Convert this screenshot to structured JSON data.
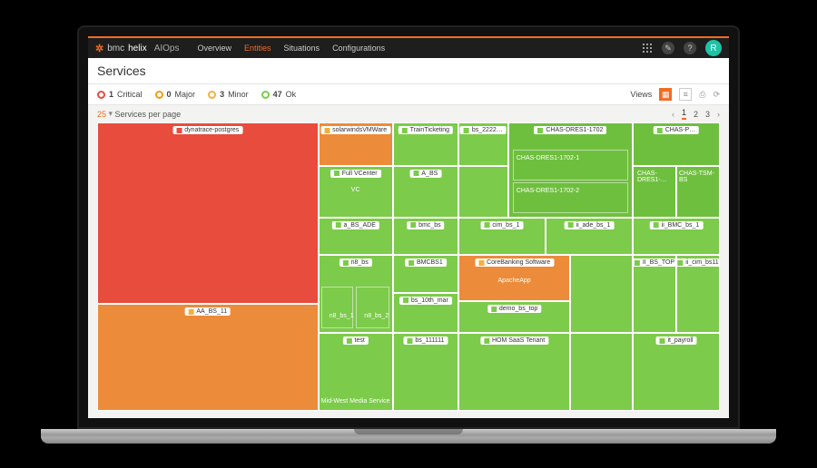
{
  "brand": {
    "bmc": "bmc",
    "helix": "helix",
    "product": "AIOps"
  },
  "nav": {
    "overview": "Overview",
    "entities": "Entities",
    "situations": "Situations",
    "configurations": "Configurations"
  },
  "avatar": "R",
  "page_title": "Services",
  "status": {
    "critical": {
      "count": "1",
      "label": "Critical"
    },
    "major": {
      "count": "0",
      "label": "Major"
    },
    "minor": {
      "count": "3",
      "label": "Minor"
    },
    "ok": {
      "count": "47",
      "label": "Ok"
    },
    "views_label": "Views"
  },
  "toolbar": {
    "perpage_count": "25",
    "perpage_label": "Services per page",
    "pages": [
      "1",
      "2",
      "3"
    ]
  },
  "tiles": {
    "dynatrace": {
      "name": "dynatrace-postgres"
    },
    "aa_bs_11": {
      "name": "AA_BS_11"
    },
    "solarwinds": {
      "name": "solarwindsVMWare"
    },
    "full_vcenter": {
      "name": "Full VCenter",
      "sub": "VC"
    },
    "a_bs_ade": {
      "name": "a_BS_ADE"
    },
    "n8_bs": {
      "name": "n8_bs",
      "sub1": "n8_bs_1",
      "sub2": "n8_bs_2"
    },
    "test": {
      "name": "test",
      "sub": "Mid-West Media Service"
    },
    "trainticketing": {
      "name": "TrainTicketing"
    },
    "a_bs": {
      "name": "A_BS"
    },
    "bmc_bs": {
      "name": "bmc_bs"
    },
    "bmcbs1": {
      "name": "BMCBS1"
    },
    "bs_10th": {
      "name": "bs_10th_mar"
    },
    "bs_111111": {
      "name": "bs_111111"
    },
    "bs_2222": {
      "name": "bs_2222…"
    },
    "chas_dres1": {
      "name": "CHAS-DRES1-1702",
      "sub1": "CHAS-DRES1-1702-1",
      "sub2": "CHAS-DRES1-1702-2"
    },
    "chas_dres1b": {
      "name": "CHAS-DRES1-…"
    },
    "chas_tsm": {
      "name": "CHAS-TSM-BS"
    },
    "chas_p": {
      "name": "CHAS-P…"
    },
    "cim_bs_1": {
      "name": "cim_bs_1"
    },
    "ii_ade_bs_1": {
      "name": "ii_ade_bs_1"
    },
    "ii_bmc_bs_1": {
      "name": "ii_BMC_bs_1"
    },
    "corebanking": {
      "name": "CoreBanking Software",
      "sub": "ApacheApp"
    },
    "demo_bs_top": {
      "name": "demo_bs_top"
    },
    "ii_bs_top": {
      "name": "II_BS_TOP"
    },
    "ii_cim_bs11": {
      "name": "ii_cim_bs11"
    },
    "hom_saas": {
      "name": "HOM SaaS Tenant"
    },
    "it_payroll": {
      "name": "it_payroll"
    }
  }
}
